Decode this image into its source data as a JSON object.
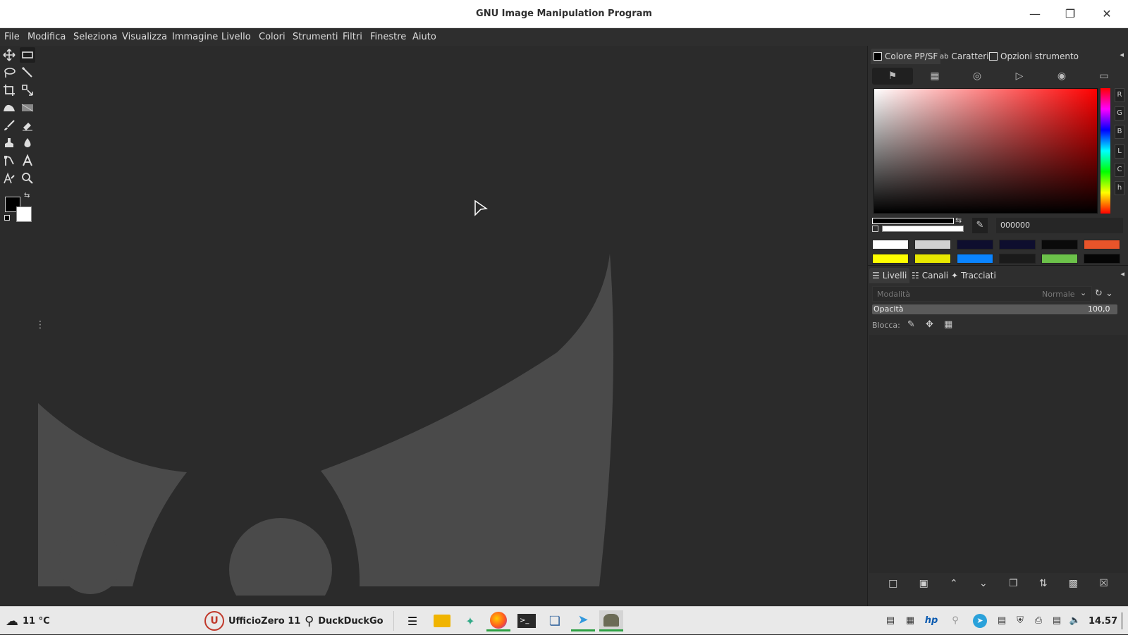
{
  "window": {
    "title": "GNU Image Manipulation Program"
  },
  "menu": [
    "File",
    "Modifica",
    "Seleziona",
    "Visualizza",
    "Immagine",
    "Livello",
    "Colori",
    "Strumenti",
    "Filtri",
    "Finestre",
    "Aiuto"
  ],
  "dock": {
    "top_tabs": [
      "Colore PP/SF",
      "Caratteri",
      "Opzioni strumento"
    ],
    "channels": [
      "R",
      "G",
      "B",
      "L",
      "C",
      "h"
    ],
    "hex_value": "000000",
    "swatches_row1": [
      "#ffffff",
      "#d0d0d0",
      "#0e0e2e",
      "#0e0e2e",
      "#0a0a0a",
      "#e8542a"
    ],
    "swatches_row2": [
      "#ffff00",
      "#e8e800",
      "#0a84ff",
      "#1a1a1a",
      "#6cc24a",
      "#050505"
    ],
    "layers_tabs": [
      "Livelli",
      "Canali",
      "Tracciati"
    ],
    "mode_label": "Modalità",
    "mode_value": "Normale",
    "opacity_label": "Opacità",
    "opacity_value": "100,0",
    "lock_label": "Blocca:"
  },
  "taskbar": {
    "weather": "11 °C",
    "ufficiozero": "UfficioZero 11",
    "search": "DuckDuckGo",
    "clock": "14.57"
  },
  "colors": {
    "fg": "#000000",
    "bg": "#ffffff",
    "accent_running": "#2ea043"
  }
}
